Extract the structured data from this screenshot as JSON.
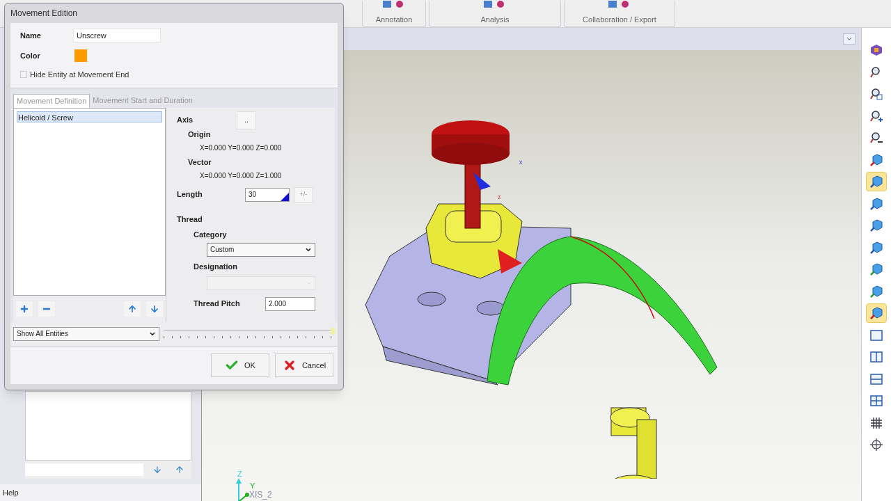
{
  "ribbon": {
    "groups": [
      {
        "label": "Annotation"
      },
      {
        "label": "Analysis"
      },
      {
        "label": "Collaboration / Export"
      }
    ]
  },
  "dialog": {
    "title": "Movement Edition",
    "name": {
      "label": "Name",
      "value": "Unscrew"
    },
    "color": {
      "label": "Color",
      "color": "#ff9900"
    },
    "hide_entity": {
      "label": "Hide Entity at Movement End",
      "checked": false
    },
    "tabs": [
      {
        "label": "Movement Definition",
        "selected": true
      },
      {
        "label": "Movement Start and Duration",
        "selected": false
      }
    ],
    "movements": [
      {
        "label": "Helicoid / Screw",
        "selected": true
      }
    ],
    "axis": {
      "label": "Axis",
      "button": "..",
      "origin_label": "Origin",
      "origin": "X=0.000 Y=0.000 Z=0.000",
      "vector_label": "Vector",
      "vector": "X=0.000 Y=0.000 Z=1.000"
    },
    "length": {
      "label": "Length",
      "value": "30",
      "toggle": "+/-"
    },
    "thread": {
      "label": "Thread",
      "category_label": "Category",
      "category": "Custom",
      "designation_label": "Designation",
      "designation_disabled": true,
      "pitch_label": "Thread Pitch",
      "pitch": "2.000"
    },
    "filter": "Show All Entities",
    "timeline": {
      "level": 1
    },
    "buttons": [
      {
        "kind": "ok",
        "label": "OK"
      },
      {
        "kind": "cancel",
        "label": "Cancel"
      }
    ]
  },
  "toolbar": [
    {
      "kind": "display",
      "selected": false
    },
    {
      "kind": "zoom-fit",
      "selected": false
    },
    {
      "kind": "zoom-window",
      "selected": false
    },
    {
      "kind": "zoom-in",
      "selected": false
    },
    {
      "kind": "zoom-out",
      "selected": false
    },
    {
      "kind": "view",
      "selected": false
    },
    {
      "kind": "view",
      "selected": true
    },
    {
      "kind": "view",
      "selected": false
    },
    {
      "kind": "view",
      "selected": false
    },
    {
      "kind": "view",
      "selected": false
    },
    {
      "kind": "view",
      "selected": false
    },
    {
      "kind": "view",
      "selected": false
    },
    {
      "kind": "view",
      "selected": true
    },
    {
      "kind": "layout-single",
      "selected": false
    },
    {
      "kind": "layout-columns",
      "selected": false
    },
    {
      "kind": "layout-rows",
      "selected": false
    },
    {
      "kind": "layout-quad",
      "selected": false
    },
    {
      "kind": "grid",
      "selected": false
    },
    {
      "kind": "snap",
      "selected": false
    }
  ],
  "viewport": {
    "triad_labels": [
      "Z",
      "Y",
      "XIS_2"
    ],
    "model_labels": [
      "z",
      "x"
    ]
  },
  "status_bar": {
    "text": "Help"
  }
}
